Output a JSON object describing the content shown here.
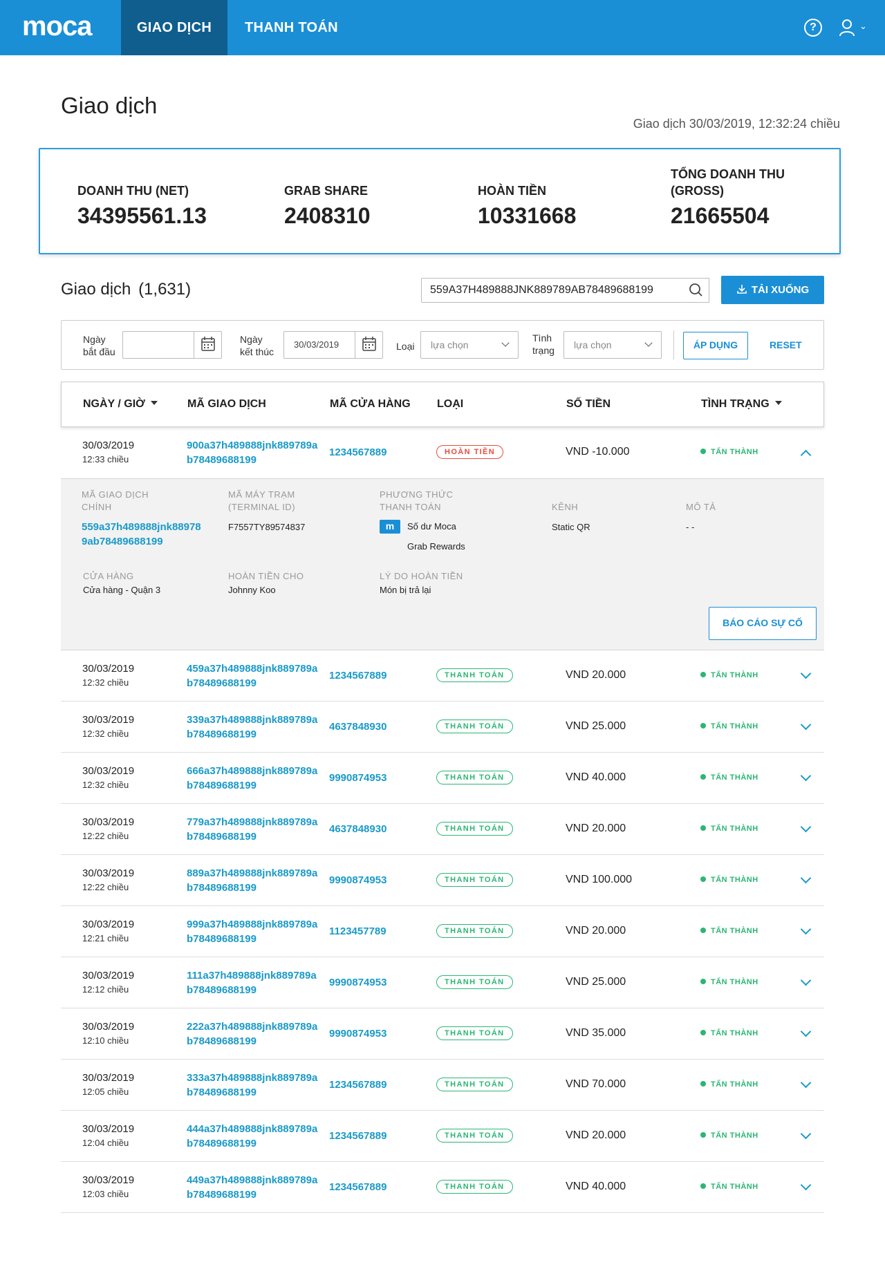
{
  "nav": {
    "logo": "moca",
    "tabs": [
      {
        "label": "GIAO DỊCH",
        "active": true
      },
      {
        "label": "THANH TOÁN",
        "active": false
      }
    ],
    "help_glyph": "?",
    "icons": [
      "help-icon",
      "user-icon",
      "chevron-down-icon"
    ]
  },
  "header": {
    "title": "Giao dịch",
    "timestamp": "Giao dịch 30/03/2019, 12:32:24 chiều"
  },
  "summary": [
    {
      "label": "DOANH THU (NET)",
      "value": "34395561.13"
    },
    {
      "label": "GRAB SHARE",
      "value": "2408310"
    },
    {
      "label": "HOÀN TIỀN",
      "value": "10331668"
    },
    {
      "label": "TỔNG DOANH THU (GROSS)",
      "value": "21665504"
    }
  ],
  "list": {
    "title": "Giao dịch",
    "count": "(1,631)",
    "search_value": "559A37H489888JNK889789AB78489688199",
    "download_label": "TẢI XUỐNG"
  },
  "filters": {
    "start_label_1": "Ngày",
    "start_label_2": "bắt đầu",
    "start_value": "",
    "end_label_1": "Ngày",
    "end_label_2": "kết thúc",
    "end_value": "30/03/2019",
    "type_label": "Loại",
    "type_value": "lựa chọn",
    "status_label_1": "Tình",
    "status_label_2": "trạng",
    "status_value": "lựa chọn",
    "apply_label": "ÁP DỤNG",
    "reset_label": "RESET"
  },
  "table": {
    "columns": [
      "NGÀY / GIỜ",
      "MÃ GIAO DỊCH",
      "MÃ CỬA HÀNG",
      "LOẠI",
      "SỐ TIỀN",
      "TÌNH TRẠNG"
    ],
    "rows": [
      {
        "date": "30/03/2019",
        "time": "12:33 chiều",
        "id": "900a37h489888jnk889789ab78489688199",
        "store": "1234567889",
        "type": "HOÀN TIỀN",
        "amount": "VND -10.000",
        "status": "TẤN THÀNH",
        "expanded": true
      },
      {
        "date": "30/03/2019",
        "time": "12:32 chiều",
        "id": "459a37h489888jnk889789ab78489688199",
        "store": "1234567889",
        "type": "THANH TOÁN",
        "amount": "VND 20.000",
        "status": "TẤN THÀNH"
      },
      {
        "date": "30/03/2019",
        "time": "12:32 chiều",
        "id": "339a37h489888jnk889789ab78489688199",
        "store": "4637848930",
        "type": "THANH TOÁN",
        "amount": "VND 25.000",
        "status": "TẤN THÀNH"
      },
      {
        "date": "30/03/2019",
        "time": "12:32 chiều",
        "id": "666a37h489888jnk889789ab78489688199",
        "store": "9990874953",
        "type": "THANH TOÁN",
        "amount": "VND 40.000",
        "status": "TẤN THÀNH"
      },
      {
        "date": "30/03/2019",
        "time": "12:22 chiều",
        "id": "779a37h489888jnk889789ab78489688199",
        "store": "4637848930",
        "type": "THANH TOÁN",
        "amount": "VND 20.000",
        "status": "TẤN THÀNH"
      },
      {
        "date": "30/03/2019",
        "time": "12:22 chiều",
        "id": "889a37h489888jnk889789ab78489688199",
        "store": "9990874953",
        "type": "THANH TOÁN",
        "amount": "VND 100.000",
        "status": "TẤN THÀNH"
      },
      {
        "date": "30/03/2019",
        "time": "12:21 chiều",
        "id": "999a37h489888jnk889789ab78489688199",
        "store": "1123457789",
        "type": "THANH TOÁN",
        "amount": "VND 20.000",
        "status": "TẤN THÀNH"
      },
      {
        "date": "30/03/2019",
        "time": "12:12 chiều",
        "id": "111a37h489888jnk889789ab78489688199",
        "store": "9990874953",
        "type": "THANH TOÁN",
        "amount": "VND 25.000",
        "status": "TẤN THÀNH"
      },
      {
        "date": "30/03/2019",
        "time": "12:10 chiều",
        "id": "222a37h489888jnk889789ab78489688199",
        "store": "9990874953",
        "type": "THANH TOÁN",
        "amount": "VND 35.000",
        "status": "TẤN THÀNH"
      },
      {
        "date": "30/03/2019",
        "time": "12:05 chiều",
        "id": "333a37h489888jnk889789ab78489688199",
        "store": "1234567889",
        "type": "THANH TOÁN",
        "amount": "VND 70.000",
        "status": "TẤN THÀNH"
      },
      {
        "date": "30/03/2019",
        "time": "12:04 chiều",
        "id": "444a37h489888jnk889789ab78489688199",
        "store": "1234567889",
        "type": "THANH TOÁN",
        "amount": "VND 20.000",
        "status": "TẤN THÀNH"
      },
      {
        "date": "30/03/2019",
        "time": "12:03 chiều",
        "id": "449a37h489888jnk889789ab78489688199",
        "store": "1234567889",
        "type": "THANH TOÁN",
        "amount": "VND 40.000",
        "status": "TẤN THÀNH"
      }
    ]
  },
  "detail": {
    "main_id_label_1": "MÃ GIAO DỊCH",
    "main_id_label_2": "CHÍNH",
    "main_id_value": "559a37h489888jnk889789ab78489688199",
    "terminal_label_1": "MÃ MÁY TRẠM",
    "terminal_label_2": "(TERMINAL ID)",
    "terminal_value": "F7557TY89574837",
    "method_label_1": "PHƯƠNG THỨC",
    "method_label_2": "THANH TOÁN",
    "method_badge": "m",
    "method_value_1": "Số dư Moca",
    "method_value_2": "Grab Rewards",
    "channel_label": "KÊNH",
    "channel_value": "Static QR",
    "desc_label": "MÔ TẢ",
    "desc_value": "- -",
    "store_label": "CỬA HÀNG",
    "store_value": "Cửa hàng - Quận 3",
    "refund_to_label": "HOÀN TIỀN CHO",
    "refund_to_value": "Johnny Koo",
    "reason_label": "LÝ DO HOÀN TIỀN",
    "reason_value": "Món bị trả lại",
    "report_label": "BÁO CÁO SỰ CỐ"
  },
  "colors": {
    "brand": "#1a8fd6",
    "brand_dark": "#0f5e8e",
    "link": "#1a9ac9",
    "success": "#2bb673",
    "refund": "#e74c3c"
  }
}
